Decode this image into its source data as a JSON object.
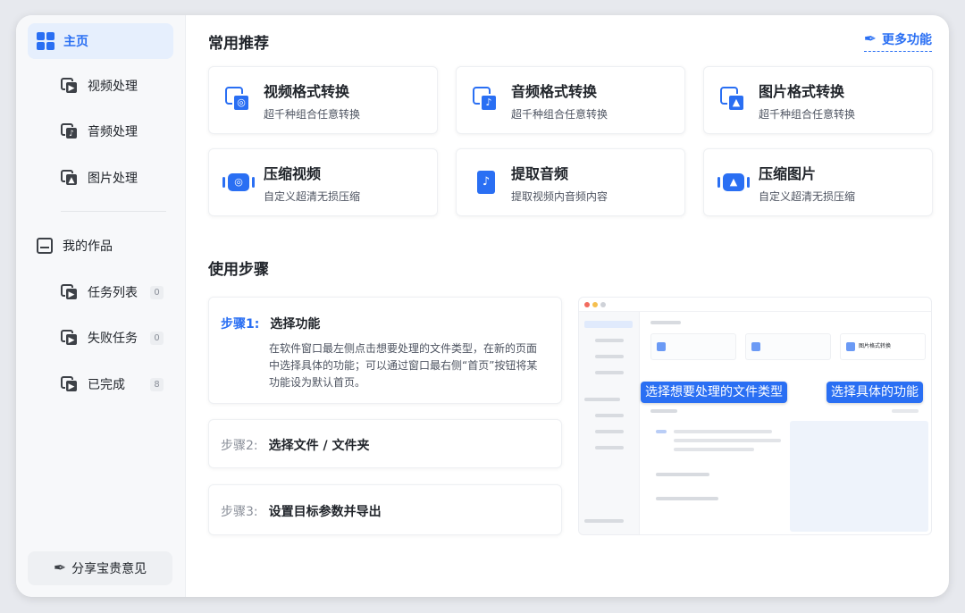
{
  "sidebar": {
    "home": "主页",
    "sub_items": [
      {
        "label": "视频处理",
        "icon": "video-file-icon"
      },
      {
        "label": "音频处理",
        "icon": "audio-file-icon"
      },
      {
        "label": "图片处理",
        "icon": "image-file-icon"
      }
    ],
    "works": "我的作品",
    "task_items": [
      {
        "label": "任务列表",
        "count": "0"
      },
      {
        "label": "失败任务",
        "count": "0"
      },
      {
        "label": "已完成",
        "count": "8"
      }
    ],
    "feedback": "分享宝贵意见"
  },
  "recommend": {
    "title": "常用推荐",
    "more": "更多功能",
    "cards": [
      {
        "title": "视频格式转换",
        "desc": "超千种组合任意转换",
        "icon": "video-convert-icon"
      },
      {
        "title": "音频格式转换",
        "desc": "超千种组合任意转换",
        "icon": "audio-convert-icon"
      },
      {
        "title": "图片格式转换",
        "desc": "超千种组合任意转换",
        "icon": "image-convert-icon"
      },
      {
        "title": "压缩视频",
        "desc": "自定义超清无损压缩",
        "icon": "video-compress-icon"
      },
      {
        "title": "提取音频",
        "desc": "提取视频内音频内容",
        "icon": "audio-extract-icon"
      },
      {
        "title": "压缩图片",
        "desc": "自定义超清无损压缩",
        "icon": "image-compress-icon"
      }
    ]
  },
  "steps": {
    "title": "使用步骤",
    "items": [
      {
        "num": "步骤1:",
        "name": "选择功能",
        "desc": "在软件窗口最左侧点击想要处理的文件类型，在新的页面中选择具体的功能；可以通过窗口最右侧“首页”按钮将某功能设为默认首页。"
      },
      {
        "num": "步骤2:",
        "name": "选择文件 / 文件夹"
      },
      {
        "num": "步骤3:",
        "name": "设置目标参数并导出"
      }
    ]
  },
  "preview": {
    "label_type": "选择想要处理的文件类型",
    "label_func": "选择具体的功能",
    "mini_card_title": "图片格式转换"
  },
  "colors": {
    "accent": "#2a6ff3",
    "accent_light": "#e6effd"
  }
}
